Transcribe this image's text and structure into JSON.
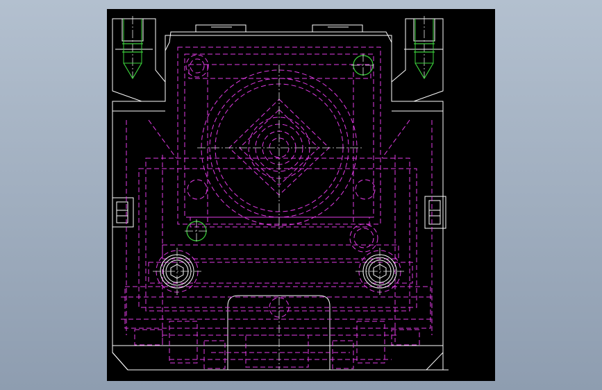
{
  "view": {
    "background": "#000000",
    "line_colors": {
      "outline": "#ffffff",
      "hidden": "#e23be6",
      "centerline": "#e8e8e8",
      "thread": "#3cd43c"
    }
  },
  "symbols": {
    "left_bolt_head": "hex-socket-icon",
    "right_bolt_head": "hex-socket-icon",
    "left_connector": "connector-icon",
    "right_connector": "connector-icon"
  }
}
